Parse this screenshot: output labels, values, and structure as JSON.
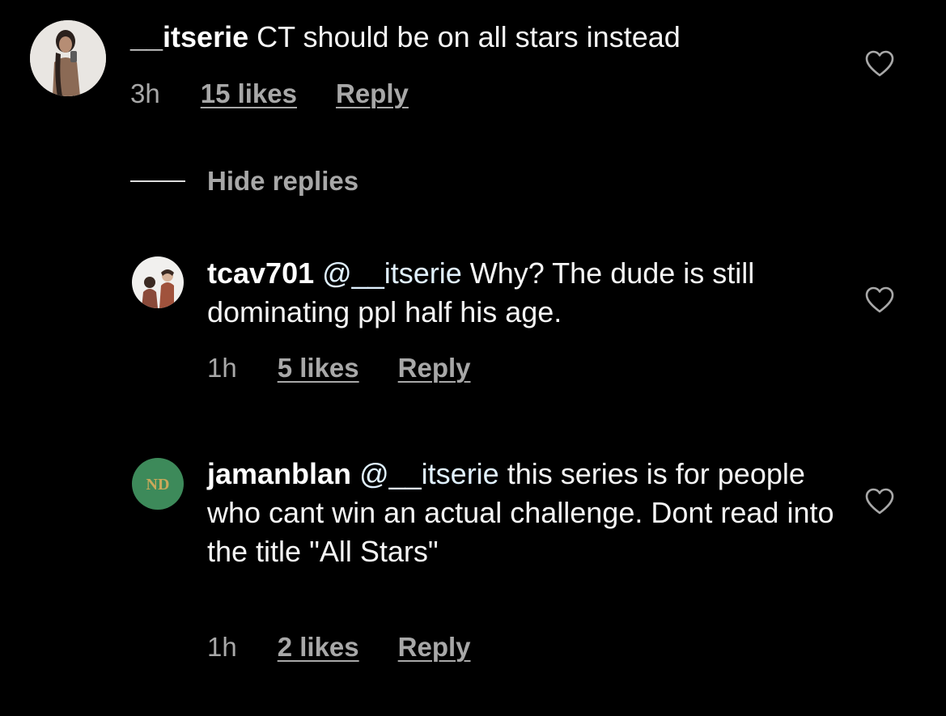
{
  "comments": [
    {
      "username": "__itserie",
      "mention": "",
      "text": "CT should be on all stars instead",
      "time": "3h",
      "likes": "15 likes",
      "reply": "Reply"
    }
  ],
  "hide_replies_label": "Hide replies",
  "replies": [
    {
      "username": "tcav701",
      "mention": "@__itserie",
      "text": "Why? The dude is still dominating ppl half his age.",
      "time": "1h",
      "likes": "5 likes",
      "reply": "Reply"
    },
    {
      "username": "jamanblan",
      "mention": "@__itserie",
      "text": "this series is for people who cant win an actual challenge. Dont read into the title \"All Stars\"",
      "time": "1h",
      "likes": "2 likes",
      "reply": "Reply"
    }
  ],
  "icons": {
    "like": "heart-outline-icon",
    "avatar_badge": "nd-monogram-icon"
  },
  "colors": {
    "background": "#000000",
    "text": "#f5f5f5",
    "secondary_text": "#a8a8a8",
    "mention": "#e0f1ff",
    "badge_green": "#3d8a5a"
  }
}
